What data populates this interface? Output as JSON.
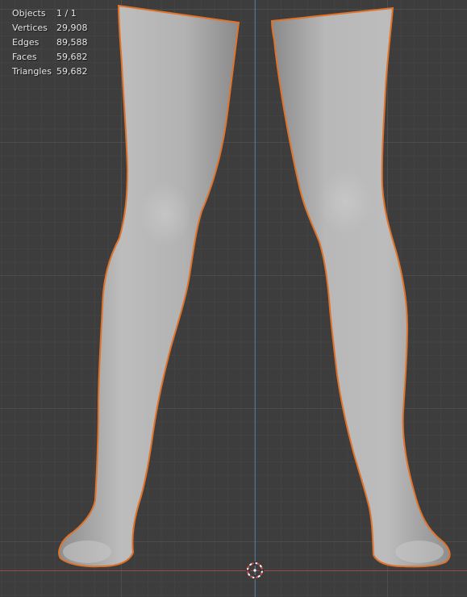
{
  "stats": {
    "objects": {
      "label": "Objects",
      "value": "1 / 1"
    },
    "vertices": {
      "label": "Vertices",
      "value": "29,908"
    },
    "edges": {
      "label": "Edges",
      "value": "89,588"
    },
    "faces": {
      "label": "Faces",
      "value": "59,682"
    },
    "triangles": {
      "label": "Triangles",
      "value": "59,682"
    }
  },
  "colors": {
    "selection_outline": "#e0722a",
    "mesh": "#b5b5b5",
    "axis_x": "#9a4a4a",
    "axis_z": "#4d6f9e",
    "background": "#3d3d3d"
  },
  "icons": {
    "cursor": "3d-cursor-icon"
  }
}
